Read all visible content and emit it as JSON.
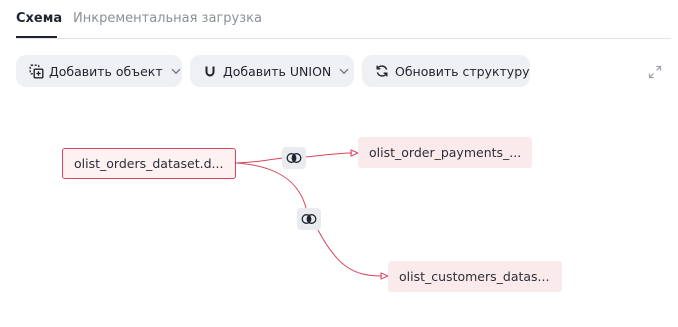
{
  "tabs": [
    {
      "label": "Схема",
      "active": true
    },
    {
      "label": "Инкрементальная загрузка",
      "active": false
    }
  ],
  "toolbar": {
    "add_object_label": "Добавить объект",
    "add_union_label": "Добавить UNION",
    "refresh_label": "Обновить структуру"
  },
  "graph": {
    "nodes": [
      {
        "label": "olist_orders_dataset.d...",
        "selected": true
      },
      {
        "label": "olist_order_payments_...",
        "selected": false
      },
      {
        "label": "olist_customers_datas...",
        "selected": false
      }
    ],
    "join_icon": "join-icon"
  },
  "colors": {
    "edge": "#d9445c",
    "node_fill": "#fbeaec",
    "selected_border": "#d9445c",
    "button_bg": "#eef0f3",
    "text": "#1f2430",
    "muted_text": "#8a8f99"
  }
}
